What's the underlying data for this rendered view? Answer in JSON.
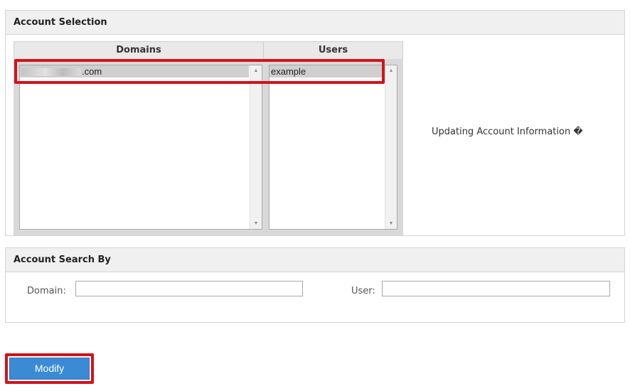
{
  "account_selection": {
    "title": "Account Selection",
    "domains_header": "Domains",
    "users_header": "Users",
    "domain_selected_suffix": ".com",
    "user_selected": "example",
    "status_text": "Updating Account Information �"
  },
  "account_search": {
    "title": "Account Search By",
    "domain_label": "Domain:",
    "domain_value": "",
    "user_label": "User:",
    "user_value": ""
  },
  "actions": {
    "modify_label": "Modify"
  },
  "colors": {
    "highlight": "#d4121a",
    "button": "#3b8bd4"
  }
}
